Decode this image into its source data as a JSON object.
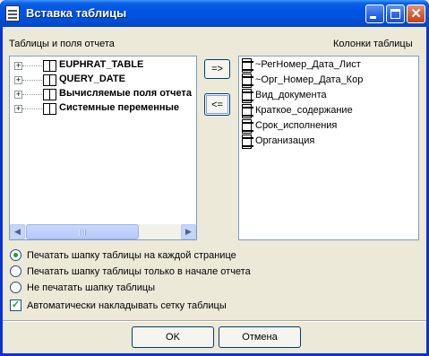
{
  "window": {
    "title": "Вставка таблицы"
  },
  "left_panel": {
    "label": "Таблицы и поля отчета",
    "items": [
      {
        "label": "EUPHRAT_TABLE",
        "expander": "+"
      },
      {
        "label": "QUERY_DATE",
        "expander": "+"
      },
      {
        "label": "Вычисляемые поля отчета",
        "expander": "+"
      },
      {
        "label": "Системные переменные",
        "expander": "+"
      }
    ]
  },
  "right_panel": {
    "label": "Колонки таблицы",
    "items": [
      "~РегНомер_Дата_Лист",
      "~Орг_Номер_Дата_Кор",
      "Вид_документа",
      "Краткое_содержание",
      "Срок_исполнения",
      "Организация"
    ]
  },
  "buttons": {
    "add": "=>",
    "remove": "<=",
    "ok": "OK",
    "cancel": "Отмена"
  },
  "options": {
    "radios": [
      {
        "label": "Печатать шапку таблицы на каждой странице",
        "checked": true
      },
      {
        "label": "Печатать шапку таблицы только в начале отчета",
        "checked": false
      },
      {
        "label": "Не печатать шапку таблицы",
        "checked": false
      }
    ],
    "checkbox": {
      "label": "Автоматически накладывать сетку таблицы",
      "checked": true,
      "mark": "✓"
    }
  },
  "icons": {
    "app": "document-icon",
    "minimize": "minimize-icon",
    "maximize": "maximize-icon",
    "close": "close-icon",
    "close_glyph": "✕",
    "scroll_left": "◀",
    "scroll_right": "▶"
  }
}
